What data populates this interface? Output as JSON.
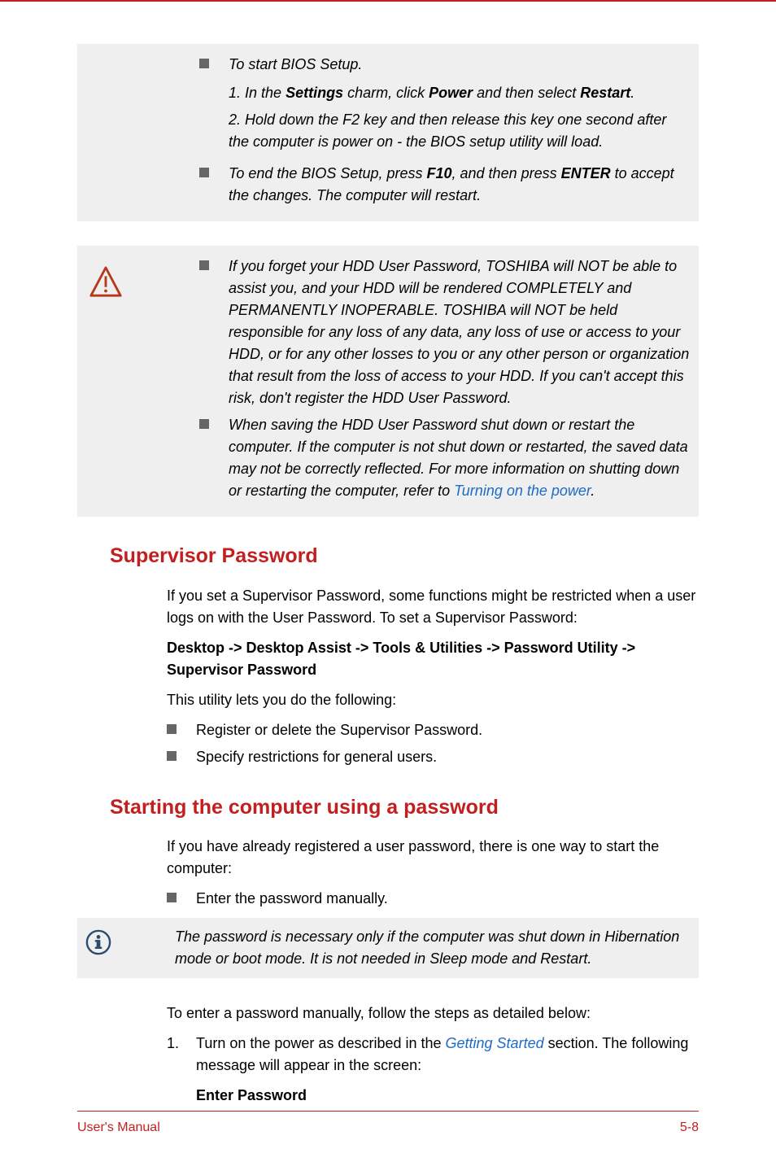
{
  "calloutBios": {
    "items": [
      {
        "intro": "To start BIOS Setup.",
        "step1_pre": "1. In the ",
        "step1_b1": "Settings",
        "step1_mid": " charm, click ",
        "step1_b2": "Power",
        "step1_mid2": " and then select ",
        "step1_b3": "Restart",
        "step1_end": ".",
        "step2": "2. Hold down the F2 key and then release this key one second after the computer is power on - the BIOS setup utility will load."
      },
      {
        "line_pre": "To end the BIOS Setup, press ",
        "line_b1": "F10",
        "line_mid": ", and then press ",
        "line_b2": "ENTER",
        "line_end": " to accept the changes. The computer will restart."
      }
    ]
  },
  "calloutWarn": {
    "item1": "If you forget your HDD User Password, TOSHIBA will NOT be able to assist you, and your HDD will be rendered COMPLETELY and PERMANENTLY INOPERABLE. TOSHIBA will NOT be held responsible for any loss of any data, any loss of use or access to your HDD, or for any other losses to you or any other person or organization that result from the loss of access to your HDD. If you can't accept this risk, don't register the HDD User Password.",
    "item2_pre": "When saving the HDD User Password shut down or restart the computer. If the computer is not shut down or restarted, the saved data may not be correctly reflected. For more information on shutting down or restarting the computer, refer to ",
    "item2_link": "Turning on the power",
    "item2_end": "."
  },
  "supervisor": {
    "heading": "Supervisor Password",
    "para1": "If you set a Supervisor Password, some functions might be restricted when a user logs on with the User Password. To set a Supervisor Password:",
    "pathBold": "Desktop -> Desktop Assist -> Tools & Utilities -> Password Utility -> Supervisor Password",
    "para2": "This utility lets you do the following:",
    "bullet1": "Register or delete the Supervisor Password.",
    "bullet2": "Specify restrictions for general users."
  },
  "starting": {
    "heading": "Starting the computer using a password",
    "para1": "If you have already registered a user password, there is one way to start the computer:",
    "bullet1": "Enter the password manually.",
    "info": "The password is necessary only if the computer was shut down in Hibernation mode or boot mode. It is not needed in Sleep mode and Restart.",
    "para2": "To enter a password manually, follow the steps as detailed below:",
    "step1_num": "1.",
    "step1_pre": "Turn on the power as described in the ",
    "step1_link": "Getting Started",
    "step1_end": " section. The following message will appear in the screen:",
    "enterPw": "Enter Password"
  },
  "footer": {
    "left": "User's Manual",
    "right": "5-8"
  }
}
